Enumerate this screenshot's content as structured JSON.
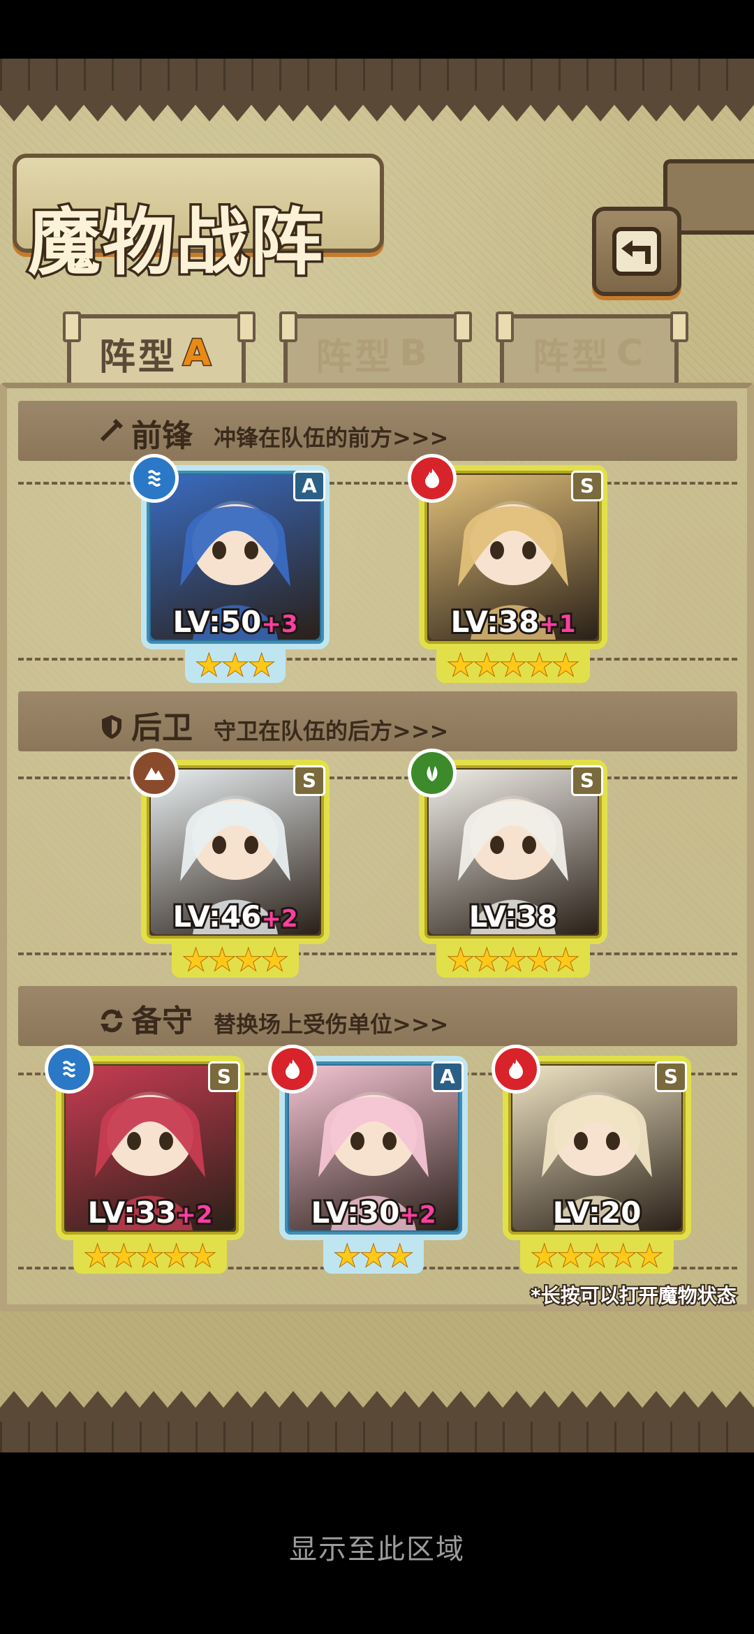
{
  "title": "魔物战阵",
  "tabs": [
    {
      "label": "阵型",
      "letter": "A",
      "active": true
    },
    {
      "label": "阵型",
      "letter": "B",
      "active": false
    },
    {
      "label": "阵型",
      "letter": "C",
      "active": false
    }
  ],
  "sections": {
    "front": {
      "title": "前锋",
      "subtitle": "冲锋在队伍的前方>>>",
      "icon": "sword-icon"
    },
    "rear": {
      "title": "后卫",
      "subtitle": "守卫在队伍的后方>>>",
      "icon": "shield-icon"
    },
    "reserve": {
      "title": "备守",
      "subtitle": "替换场上受伤单位>>>",
      "icon": "swap-icon"
    }
  },
  "units": {
    "front_1": {
      "rank": "A",
      "element": "water",
      "element_color": "#2a78c6",
      "lv": "LV:50",
      "plus": "+3",
      "stars": 3,
      "art_color": "#3a6cc2"
    },
    "front_2": {
      "rank": "S",
      "element": "fire",
      "element_color": "#d8232a",
      "lv": "LV:38",
      "plus": "+1",
      "stars": 5,
      "art_color": "#e2c07a"
    },
    "rear_1": {
      "rank": "S",
      "element": "earth",
      "element_color": "#8a4b2c",
      "lv": "LV:46",
      "plus": "+2",
      "stars": 4,
      "art_color": "#e8eef0"
    },
    "rear_2": {
      "rank": "S",
      "element": "nature",
      "element_color": "#3c8a2a",
      "lv": "LV:38",
      "plus": "",
      "stars": 5,
      "art_color": "#f0eee8"
    },
    "reserve_1": {
      "rank": "S",
      "element": "water",
      "element_color": "#2a78c6",
      "lv": "LV:33",
      "plus": "+2",
      "stars": 5,
      "art_color": "#c83c52"
    },
    "reserve_2": {
      "rank": "A",
      "element": "fire",
      "element_color": "#d8232a",
      "lv": "LV:30",
      "plus": "+2",
      "stars": 3,
      "art_color": "#f4c4d4"
    },
    "reserve_3": {
      "rank": "S",
      "element": "fire",
      "element_color": "#d8232a",
      "lv": "LV:20",
      "plus": "",
      "stars": 5,
      "art_color": "#efe4c4"
    }
  },
  "hint": "*长按可以打开魔物状态",
  "bottom_label": "显示至此区域"
}
